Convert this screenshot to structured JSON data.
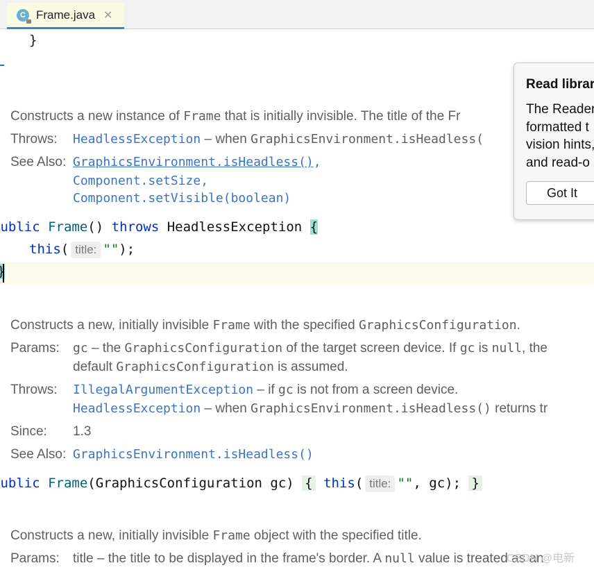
{
  "tab": {
    "icon_letter": "C",
    "title": "Frame.java",
    "close": "✕"
  },
  "code": {
    "brace_close": "}",
    "ctor1_keyword": "public",
    "ctor1_name": "Frame",
    "ctor1_params": "()",
    "throws_kw": "throws",
    "exception": "HeadlessException",
    "open_brace": "{",
    "this_kw": "this",
    "hint_title": "title:",
    "empty_string": "\"\"",
    "call_end": ");",
    "ctor2_params": "(GraphicsConfiguration gc)",
    "gc_arg": ", gc);",
    "close_brace": "}"
  },
  "doc1": {
    "text_a": "Constructs a new instance of ",
    "code_frame": "Frame",
    "text_b": " that is initially invisible. The title of the Fr",
    "throws_label": "Throws:",
    "throws_link": "HeadlessException",
    "throws_text": " – when ",
    "throws_code": "GraphicsEnvironment.isHeadless(",
    "see_label": "See Also:",
    "see1": "GraphicsEnvironment.isHeadless()",
    "see1_comma": ",",
    "see2": "Component.setSize",
    "see2_comma": ",",
    "see3": "Component.setVisible(boolean)"
  },
  "doc2": {
    "text_a": "Constructs a new, initially invisible ",
    "code_frame": "Frame",
    "text_b": " with the specified ",
    "code_gc": "GraphicsConfiguration",
    "text_c": ".",
    "params_label": "Params:",
    "p_name": "gc",
    "p_text_a": " – the ",
    "p_code": "GraphicsConfiguration",
    "p_text_b": " of the target screen device. If ",
    "p_code2": "gc",
    "p_text_c": " is ",
    "p_null": "null",
    "p_text_d": ", the",
    "p_line2_a": "default ",
    "p_line2_code": "GraphicsConfiguration",
    "p_line2_b": " is assumed.",
    "throws_label": "Throws:",
    "t1_link": "IllegalArgumentException",
    "t1_text_a": " – if ",
    "t1_code": "gc",
    "t1_text_b": " is not from a screen device.",
    "t2_link": "HeadlessException",
    "t2_text_a": " – when ",
    "t2_code": "GraphicsEnvironment.isHeadless()",
    "t2_text_b": " returns tr",
    "since_label": "Since:",
    "since_value": "1.3",
    "see_label": "See Also:",
    "see1": "GraphicsEnvironment.isHeadless()"
  },
  "doc3": {
    "text_a": "Constructs a new, initially invisible ",
    "code_frame": "Frame",
    "text_b": " object with the specified title.",
    "params_label": "Params:",
    "p_text_a": "title – the title to be displayed in the frame's border. A ",
    "p_null": "null",
    "p_text_b": " value is treated as an"
  },
  "popup": {
    "title": "Read librar",
    "lines": [
      "The Reader",
      "formatted t",
      "vision hints,",
      "and read-o"
    ],
    "button": "Got It"
  },
  "watermark": "CSDN @电新"
}
